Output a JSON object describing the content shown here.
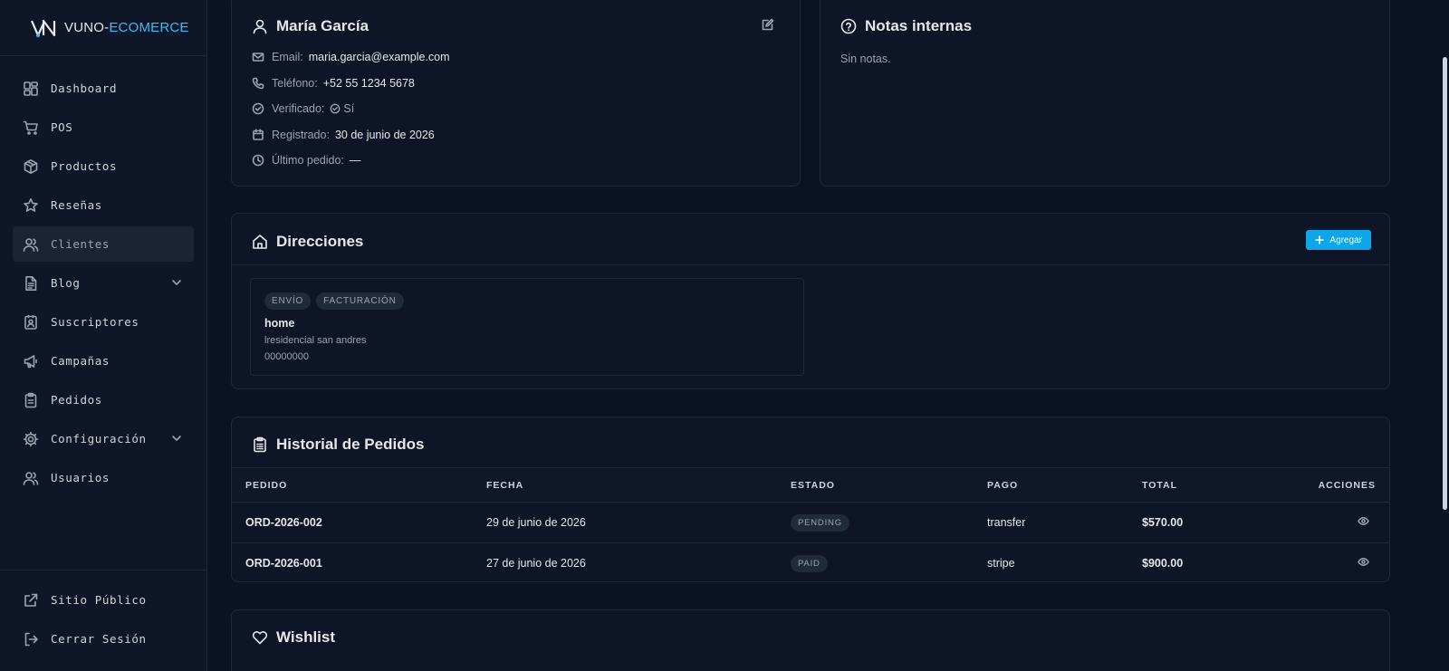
{
  "brand": {
    "name_part1": "VUNO-",
    "name_part2": "ECOMERCE"
  },
  "sidebar": {
    "items": [
      {
        "label": "Dashboard",
        "icon": "dashboard-icon"
      },
      {
        "label": "POS",
        "icon": "cart-icon"
      },
      {
        "label": "Productos",
        "icon": "box-icon"
      },
      {
        "label": "Reseñas",
        "icon": "star-icon"
      },
      {
        "label": "Clientes",
        "icon": "users-icon",
        "active": true
      },
      {
        "label": "Blog",
        "icon": "document-icon",
        "expandable": true
      },
      {
        "label": "Suscriptores",
        "icon": "contact-icon"
      },
      {
        "label": "Campañas",
        "icon": "megaphone-icon"
      },
      {
        "label": "Pedidos",
        "icon": "clipboard-icon"
      },
      {
        "label": "Configuración",
        "icon": "gear-icon",
        "expandable": true
      },
      {
        "label": "Usuarios",
        "icon": "users-icon"
      }
    ],
    "bottom": [
      {
        "label": "Sitio Público",
        "icon": "external-link-icon"
      },
      {
        "label": "Cerrar Sesión",
        "icon": "logout-icon"
      }
    ]
  },
  "customer": {
    "name": "María García",
    "email_label": "Email:",
    "email": "maria.garcia@example.com",
    "phone_label": "Teléfono:",
    "phone": "+52 55 1234 5678",
    "verified_label": "Verificado:",
    "verified": "Sí",
    "registered_label": "Registrado:",
    "registered": "30 de junio de 2026",
    "last_order_label": "Último pedido:",
    "last_order": "—"
  },
  "notes": {
    "title": "Notas internas",
    "body": "Sin notas."
  },
  "addresses": {
    "title": "Direcciones",
    "add_label": "Agregar",
    "items": [
      {
        "badges": [
          "ENVÍO",
          "FACTURACIÓN"
        ],
        "name": "home",
        "line1": "lresidencial san andres",
        "line2": "00000000"
      }
    ]
  },
  "orders": {
    "title": "Historial de Pedidos",
    "columns": [
      "PEDIDO",
      "FECHA",
      "ESTADO",
      "PAGO",
      "TOTAL",
      "ACCIONES"
    ],
    "rows": [
      {
        "id": "ORD-2026-002",
        "date": "29 de junio de 2026",
        "status": "PENDING",
        "payment": "transfer",
        "total": "$570.00"
      },
      {
        "id": "ORD-2026-001",
        "date": "27 de junio de 2026",
        "status": "PAID",
        "payment": "stripe",
        "total": "$900.00"
      }
    ]
  },
  "wishlist": {
    "title": "Wishlist"
  },
  "colors": {
    "accent": "#0ea5e9",
    "background": "#0b1222",
    "card": "#0d1526",
    "border": "#1e293b"
  }
}
